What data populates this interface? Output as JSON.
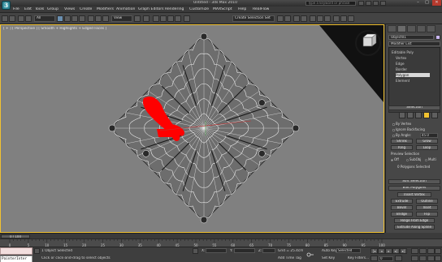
{
  "window": {
    "title": "Untitled - 3ds Max 2010",
    "help_placeholder": "Type a keyword or phrase",
    "min": "–",
    "max": "□",
    "close": "✕"
  },
  "menu": [
    "File",
    "Edit",
    "Tools",
    "Group",
    "Views",
    "Create",
    "Modifiers",
    "Animation",
    "Graph Editors",
    "Rendering",
    "Customize",
    "MAXScript",
    "Help",
    "RealFlow"
  ],
  "toolbar": {
    "selection_filter": "All",
    "ref_coord": "View",
    "named_sel": "Create Selection Set"
  },
  "viewport": {
    "label": "[ + ] [ Perspective ] [ Smooth + Highlights + Edged Faces ]"
  },
  "command_panel": {
    "object_name": "Object01",
    "modifier_list": "Modifier List",
    "stack": [
      "Editable Poly",
      "Vertex",
      "Edge",
      "Border",
      "Polygon",
      "Element"
    ],
    "stack_selected_index": 4,
    "selection": {
      "title": "Selection",
      "by_vertex": "By Vertex",
      "ignore_backfacing": "Ignore Backfacing",
      "by_angle": "By Angle:",
      "angle": "45.0",
      "shrink": "Shrink",
      "grow": "Grow",
      "ring": "Ring",
      "loop": "Loop",
      "preview_selection": "Preview Selection",
      "preview_off": "Off",
      "preview_subobj": "SubObj",
      "preview_multi": "Multi",
      "status": "0 Polygons Selected"
    },
    "soft_selection": "Soft Selection",
    "edit_polygons": {
      "title": "Edit Polygons",
      "insert_vertex": "Insert Vertex",
      "extrude": "Extrude",
      "outline": "Outline",
      "bevel": "Bevel",
      "inset": "Inset",
      "bridge": "Bridge",
      "flip": "Flip",
      "hinge": "Hinge From Edge",
      "extrude_spline": "Extrude Along Spline",
      "edit_triangulation": "Edit Triangulation",
      "retriangulate": "Retriangulate",
      "turn": "Turn"
    }
  },
  "timeline": {
    "frame": "0 / 100",
    "ticks": [
      "0",
      "5",
      "10",
      "15",
      "20",
      "25",
      "30",
      "35",
      "40",
      "45",
      "50",
      "55",
      "60",
      "65",
      "70",
      "75",
      "80",
      "85",
      "90",
      "95",
      "100"
    ]
  },
  "status": {
    "maxscript_text": "PainterInter",
    "selected": "1 Object Selected",
    "prompt": "Click or click-and-drag to select objects",
    "x_label": "X:",
    "y_label": "Y:",
    "z_label": "Z:",
    "grid": "Grid = 25.4cm",
    "auto_key": "Auto Key",
    "set_key": "Set Key",
    "key_mode": "Selected",
    "key_filters": "Key Filters...",
    "add_time_tag": "Add Time Tag",
    "frame_field": "0"
  },
  "colors": {
    "viewport_bg": "#808080",
    "active_border": "#f2c230",
    "selected_faces": "#ff0000",
    "wire": "#ffffff"
  },
  "icons": [
    "app-logo-icon",
    "viewcube-icon",
    "lock-icon",
    "key-icon",
    "play-icon"
  ]
}
